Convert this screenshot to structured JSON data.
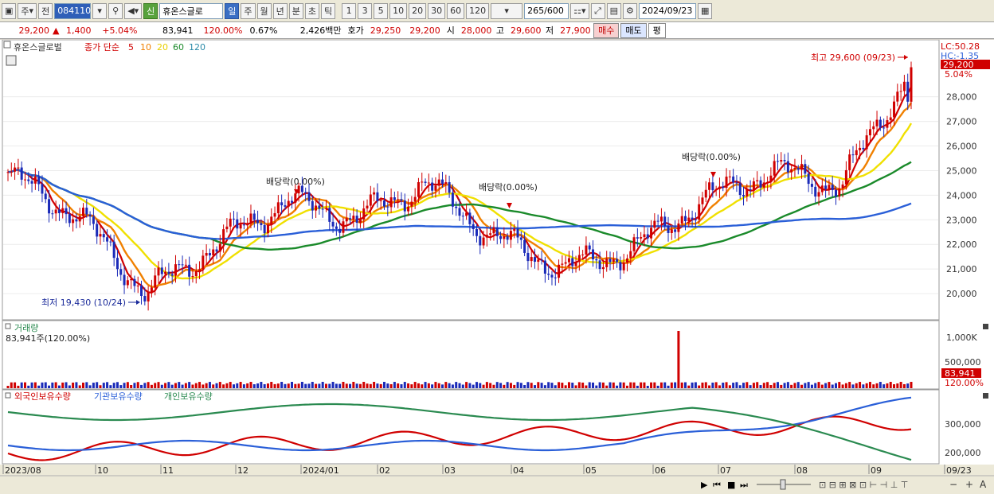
{
  "toolbar": {
    "tab_stock": "주",
    "tab_prev": "전",
    "code": "084110",
    "name": "휴온스글로",
    "new_label": "신",
    "periods": [
      "일",
      "주",
      "월",
      "년",
      "분",
      "초",
      "틱"
    ],
    "active_period": "일",
    "numbers": [
      "1",
      "3",
      "5",
      "10",
      "20",
      "30",
      "60",
      "120"
    ],
    "count_value": "265",
    "count_total": "/600",
    "date": "2024/09/23"
  },
  "quote": {
    "price": "29,200",
    "arrow": "▲",
    "change": "1,400",
    "change_pct": "+5.04%",
    "volume": "83,941",
    "volume_ratio": "120.00%",
    "turnover": "0.67%",
    "amount": "2,426백만",
    "ask_label": "호가",
    "ask": "29,250",
    "bid": "29,200",
    "open_label": "시",
    "open": "28,000",
    "high_label": "고",
    "high": "29,600",
    "low_label": "저",
    "low": "27,900",
    "buy_label": "매수",
    "sell_label": "매도",
    "eval_label": "평"
  },
  "price_panel": {
    "stock_title": "휴온스글로벌",
    "legend_prefix": "종가 단순",
    "ma_labels": [
      "5",
      "10",
      "20",
      "60",
      "120"
    ],
    "ma_colors": [
      "#d00000",
      "#f08000",
      "#f0e000",
      "#1a8a2a",
      "#2a5fd8"
    ],
    "lc": "LC:50.28",
    "hc": "HC:-1.35",
    "last_price_label": "29,200",
    "last_pct_label": "5.04%",
    "high_annotation": "최고 29,600 (09/23)",
    "low_annotation": "최저 19,430 (10/24)",
    "dividend_labels": [
      "배당락(0.00%)",
      "배당락(0.00%)",
      "배당락(0.00%)"
    ],
    "y_ticks": [
      "28,000",
      "27,000",
      "26,000",
      "25,000",
      "24,000",
      "23,000",
      "22,000",
      "21,000",
      "20,000"
    ]
  },
  "volume_panel": {
    "title": "거래량",
    "value_label": "83,941주(120.00%)",
    "y_ticks": [
      "1,000K",
      "500,000"
    ],
    "last_label": "83,941",
    "last_pct": "120.00%"
  },
  "holdings_panel": {
    "series_labels": [
      "외국인보유수량",
      "기관보유수량",
      "개인보유수량"
    ],
    "series_colors": [
      "#d00000",
      "#2a5fd8",
      "#2a8a50"
    ],
    "y_ticks": [
      "300,000",
      "200,000"
    ]
  },
  "x_axis": {
    "labels": [
      "2023/08",
      "10",
      "11",
      "12",
      "2024/01",
      "02",
      "03",
      "04",
      "05",
      "06",
      "07",
      "08",
      "09",
      "09/23"
    ]
  },
  "chart_data": {
    "type": "candlestick",
    "title": "휴온스글로벌",
    "moving_averages": [
      "5",
      "10",
      "20",
      "60",
      "120"
    ],
    "period_high": {
      "value": 29600,
      "date": "09/23"
    },
    "period_low": {
      "value": 19430,
      "date": "10/24"
    },
    "monthly_approx_close": [
      {
        "month": "2023/08",
        "close": 24800
      },
      {
        "month": "2023/09",
        "close": 23200
      },
      {
        "month": "2023/10",
        "close": 20000
      },
      {
        "month": "2023/11",
        "close": 22000
      },
      {
        "month": "2023/12",
        "close": 23800
      },
      {
        "month": "2024/01",
        "close": 23000
      },
      {
        "month": "2024/02",
        "close": 24500
      },
      {
        "month": "2024/03",
        "close": 22300
      },
      {
        "month": "2024/04",
        "close": 21000
      },
      {
        "month": "2024/05",
        "close": 21800
      },
      {
        "month": "2024/06",
        "close": 23800
      },
      {
        "month": "2024/07",
        "close": 25000
      },
      {
        "month": "2024/08",
        "close": 24400
      },
      {
        "month": "2024/09",
        "close": 29200
      }
    ],
    "last": {
      "close": 29200,
      "change": 1400,
      "change_pct": 5.04,
      "volume": 83941
    }
  }
}
